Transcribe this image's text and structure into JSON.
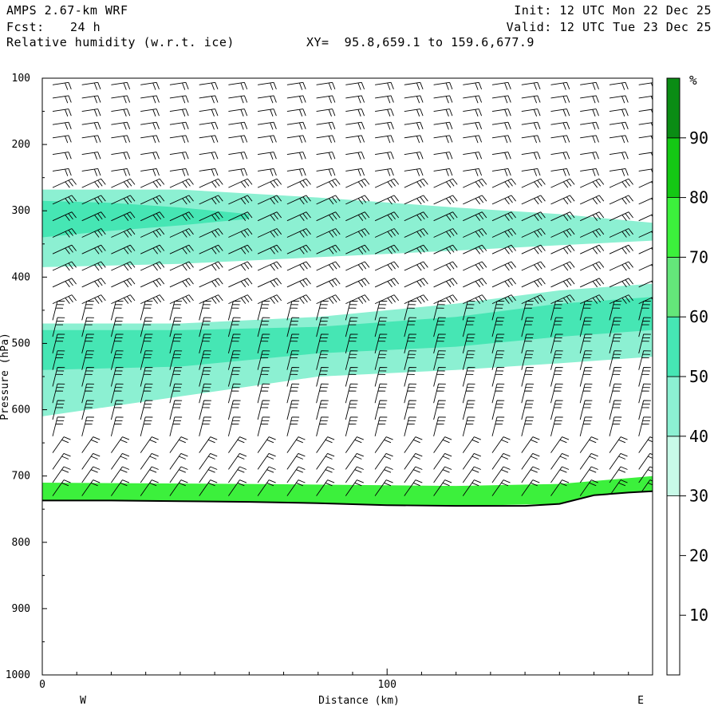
{
  "header": {
    "model": "AMPS 2.67-km WRF",
    "forecast_label": "Fcst:",
    "forecast_value": "24 h",
    "field": "Relative humidity (w.r.t. ice)",
    "xy": "XY=  95.8,659.1 to 159.6,677.9",
    "init": "Init: 12 UTC Mon 22 Dec 25",
    "valid": "Valid: 12 UTC Tue 23 Dec 25"
  },
  "chart_data": {
    "type": "heatmap",
    "title": "Relative humidity (w.r.t. ice)",
    "xlabel": "Distance (km)",
    "ylabel": "Pressure (hPa)",
    "xlim": [
      0,
      177
    ],
    "ylim": [
      1000,
      100
    ],
    "x_ticks": [
      0,
      100
    ],
    "y_ticks": [
      100,
      200,
      300,
      400,
      500,
      600,
      700,
      800,
      900,
      1000
    ],
    "x_end_labels": [
      "W",
      "E"
    ],
    "colorbar": {
      "unit": "%",
      "ticks": [
        10,
        20,
        30,
        40,
        50,
        60,
        70,
        80,
        90
      ],
      "levels": [
        0,
        30,
        40,
        50,
        60,
        70,
        80,
        90,
        100
      ],
      "colors": [
        "#ffffff",
        "#c8fae8",
        "#8cf0d2",
        "#46e6b4",
        "#64e67a",
        "#3cf03c",
        "#14c814",
        "#0a8c14",
        "#006e1e"
      ]
    },
    "terrain_pressure": {
      "x": [
        0,
        20,
        40,
        60,
        80,
        100,
        120,
        140,
        150,
        160,
        170,
        177
      ],
      "p": [
        737,
        737,
        738,
        739,
        741,
        744,
        745,
        745,
        742,
        729,
        725,
        723
      ]
    },
    "bands": [
      {
        "name": "upper moist layer",
        "rh": 45,
        "x": [
          0,
          40,
          80,
          120,
          150,
          177
        ],
        "top": [
          268,
          268,
          280,
          295,
          305,
          318
        ],
        "bottom": [
          385,
          380,
          370,
          360,
          352,
          345
        ]
      },
      {
        "name": "upper moist layer core",
        "rh": 55,
        "x": [
          0,
          20,
          40,
          60
        ],
        "top": [
          285,
          288,
          295,
          305
        ],
        "bottom": [
          340,
          330,
          322,
          312
        ]
      },
      {
        "name": "mid moist layer",
        "rh": 40,
        "x": [
          0,
          40,
          80,
          120,
          150,
          177
        ],
        "top": [
          470,
          470,
          460,
          440,
          420,
          410
        ],
        "bottom": [
          610,
          580,
          550,
          540,
          530,
          520
        ]
      },
      {
        "name": "mid moist layer core",
        "rh": 50,
        "x": [
          0,
          40,
          80,
          120,
          150,
          177
        ],
        "top": [
          480,
          480,
          475,
          460,
          440,
          430
        ],
        "bottom": [
          540,
          535,
          515,
          505,
          490,
          480
        ]
      },
      {
        "name": "near-surface moist layer",
        "rh": 75,
        "x": [
          0,
          60,
          120,
          150,
          177
        ],
        "top": [
          710,
          712,
          715,
          712,
          700
        ],
        "bottom": [
          737,
          739,
          745,
          742,
          723
        ]
      }
    ],
    "wind_barbs": {
      "columns_x": [
        3,
        11.5,
        20,
        28.5,
        37,
        45.5,
        54,
        62.5,
        71,
        79.5,
        88,
        96.5,
        105,
        113.5,
        122,
        130.5,
        139,
        147.5,
        156,
        164.5,
        173
      ],
      "levels_p": [
        110,
        130,
        150,
        170,
        190,
        215,
        240,
        265,
        290,
        315,
        340,
        365,
        390,
        415,
        440,
        465,
        490,
        515,
        540,
        565,
        590,
        615,
        640,
        665,
        690,
        710,
        730
      ]
    }
  }
}
